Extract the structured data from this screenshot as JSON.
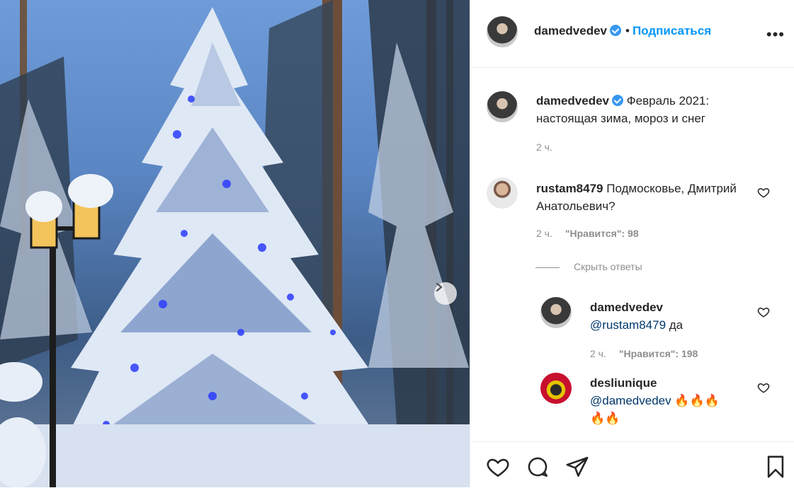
{
  "post": {
    "author": "damedvedev",
    "follow_label": "Подписаться",
    "caption": "Февраль 2021: настоящая зима, мороз и снег",
    "caption_time": "2 ч."
  },
  "comments": [
    {
      "username": "rustam8479",
      "text": "Подмосковье, Дмитрий Анатольевич?",
      "time": "2 ч.",
      "likes": "\"Нравится\": 98"
    }
  ],
  "hide_replies_label": "Скрыть ответы",
  "replies": [
    {
      "username": "damedvedev",
      "mention": "@rustam8479",
      "text": " да",
      "time": "2 ч.",
      "likes": "\"Нравится\": 198"
    },
    {
      "username": "desliunique",
      "mention": "@damedvedev",
      "text": " 🔥🔥🔥",
      "text2": "🔥🔥"
    }
  ],
  "icons": {
    "more": "more-options-icon",
    "verified": "verified-badge-icon",
    "like": "heart-icon",
    "comment": "comment-icon",
    "share": "share-icon",
    "save": "bookmark-icon",
    "next": "chevron-right-icon"
  }
}
